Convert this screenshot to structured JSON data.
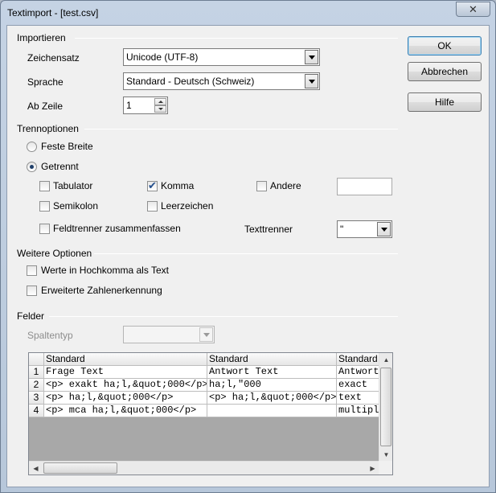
{
  "window": {
    "title": "Textimport - [test.csv]",
    "close_glyph": "✕"
  },
  "buttons": {
    "ok": "OK",
    "cancel": "Abbrechen",
    "help": "Hilfe"
  },
  "import": {
    "section": "Importieren",
    "charset_label": "Zeichensatz",
    "charset_value": "Unicode (UTF-8)",
    "language_label": "Sprache",
    "language_value": "Standard - Deutsch (Schweiz)",
    "fromrow_label": "Ab Zeile",
    "fromrow_value": "1"
  },
  "separator": {
    "section": "Trennoptionen",
    "fixed_width": "Feste Breite",
    "separated": "Getrennt",
    "tab": "Tabulator",
    "comma": "Komma",
    "other": "Andere",
    "semicolon": "Semikolon",
    "space": "Leerzeichen",
    "merge": "Feldtrenner zusammenfassen",
    "text_delimiter_label": "Texttrenner",
    "text_delimiter_value": "\"",
    "checked": {
      "tab": false,
      "comma": true,
      "other": false,
      "semicolon": false,
      "space": false,
      "merge": false
    },
    "selected_mode": "separated"
  },
  "other_options": {
    "section": "Weitere Optionen",
    "quoted_as_text": "Werte in Hochkomma als Text",
    "detect_special": "Erweiterte Zahlenerkennung"
  },
  "fields": {
    "section": "Felder",
    "column_type_label": "Spaltentyp",
    "column_type_value": "",
    "headers": [
      "Standard",
      "Standard",
      "Standard"
    ],
    "rows": [
      {
        "num": "1",
        "cells": [
          "Frage Text",
          "Antwort Text",
          "Antwortt"
        ]
      },
      {
        "num": "2",
        "cells": [
          "<p> exakt ha;l,&quot;000</p>",
          "ha;l,\"000",
          "exact"
        ]
      },
      {
        "num": "3",
        "cells": [
          "<p> ha;l,&quot;000</p>",
          "<p> ha;l,&quot;000</p>",
          "text"
        ]
      },
      {
        "num": "4",
        "cells": [
          "<p> mca ha;l,&quot;000</p>",
          "",
          "multiple"
        ]
      }
    ],
    "scroll_left": "◀",
    "scroll_right": "▶",
    "scroll_up": "▲",
    "scroll_down": "▼"
  }
}
